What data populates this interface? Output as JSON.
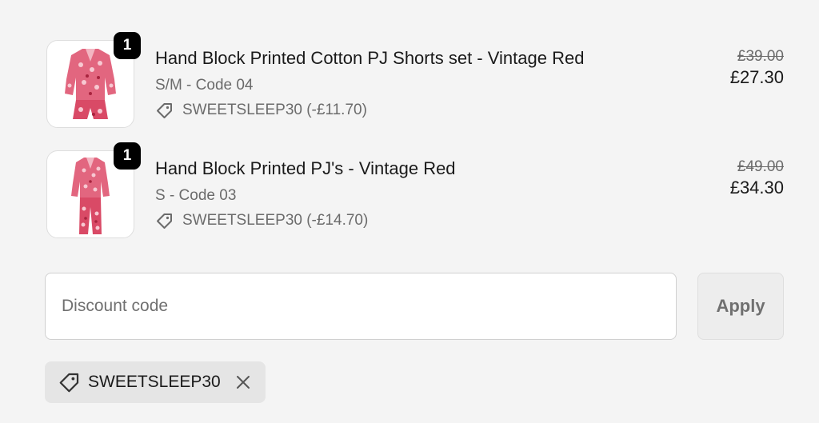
{
  "line_items": [
    {
      "quantity": "1",
      "title": "Hand Block Printed Cotton PJ Shorts set - Vintage Red",
      "variant": "S/M - Code 04",
      "discount_label": "SWEETSLEEP30 (-£11.70)",
      "original_price": "£39.00",
      "final_price": "£27.30",
      "image_icon": "pj-shorts-set-image"
    },
    {
      "quantity": "1",
      "title": "Hand Block Printed PJ's - Vintage Red",
      "variant": "S - Code 03",
      "discount_label": "SWEETSLEEP30 (-£14.70)",
      "original_price": "£49.00",
      "final_price": "£34.30",
      "image_icon": "pj-set-image"
    }
  ],
  "discount_form": {
    "placeholder": "Discount code",
    "value": "",
    "apply_label": "Apply"
  },
  "applied_discount": {
    "code": "SWEETSLEEP30",
    "tag_icon": "tag-icon",
    "remove_icon": "close-icon"
  },
  "colors": {
    "background": "#f4f4f4",
    "badge": "#000000",
    "product_print": "#d94a66"
  }
}
